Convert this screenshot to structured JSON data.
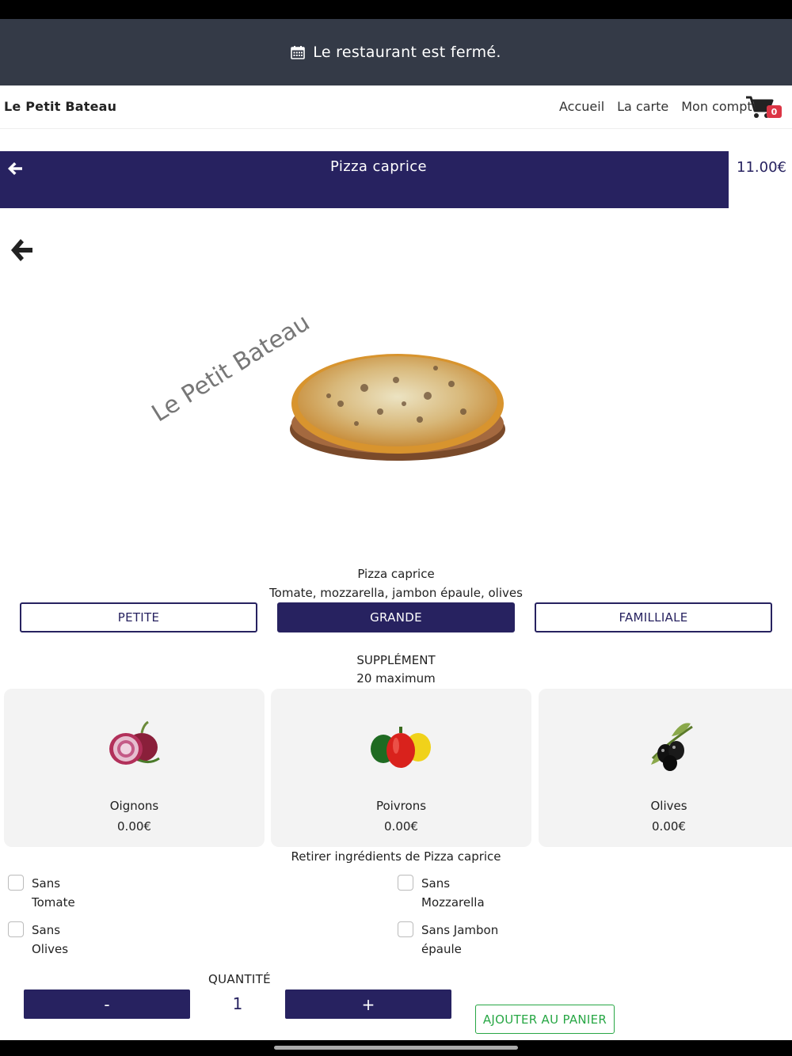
{
  "banner": {
    "text": "Le restaurant est fermé.",
    "icon": "calendar-icon"
  },
  "nav": {
    "brand": "Le Petit Bateau",
    "links": [
      "Accueil",
      "La carte",
      "Mon compte"
    ],
    "cart_count": "0"
  },
  "product": {
    "title": "Pizza caprice",
    "price": "11.00€",
    "watermark": "Le Petit Bateau",
    "name": "Pizza caprice",
    "ingredients": "Tomate, mozzarella, jambon épaule, olives"
  },
  "sizes": [
    {
      "label": "PETITE",
      "active": false
    },
    {
      "label": "GRANDE",
      "active": true
    },
    {
      "label": "FAMILLIALE",
      "active": false
    }
  ],
  "supplements": {
    "title": "SUPPLÉMENT",
    "subtitle": "20 maximum",
    "items": [
      {
        "name": "Oignons",
        "price": "0.00€"
      },
      {
        "name": "Poivrons",
        "price": "0.00€"
      },
      {
        "name": "Olives",
        "price": "0.00€"
      }
    ]
  },
  "remove": {
    "title": "Retirer ingrédients de Pizza caprice",
    "items": [
      {
        "line1": "Sans",
        "line2": "Tomate"
      },
      {
        "line1": "Sans",
        "line2": "Mozzarella"
      },
      {
        "line1": "Sans",
        "line2": "Olives"
      },
      {
        "line1": "Sans Jambon",
        "line2": "épaule"
      }
    ]
  },
  "quantity": {
    "label": "QUANTITÉ",
    "value": "1",
    "minus": "-",
    "plus": "+"
  },
  "add_to_cart": "AJOUTER AU PANIER",
  "colors": {
    "primary": "#272260",
    "banner": "#343a47",
    "success": "#28a745",
    "badge": "#dc3545"
  }
}
